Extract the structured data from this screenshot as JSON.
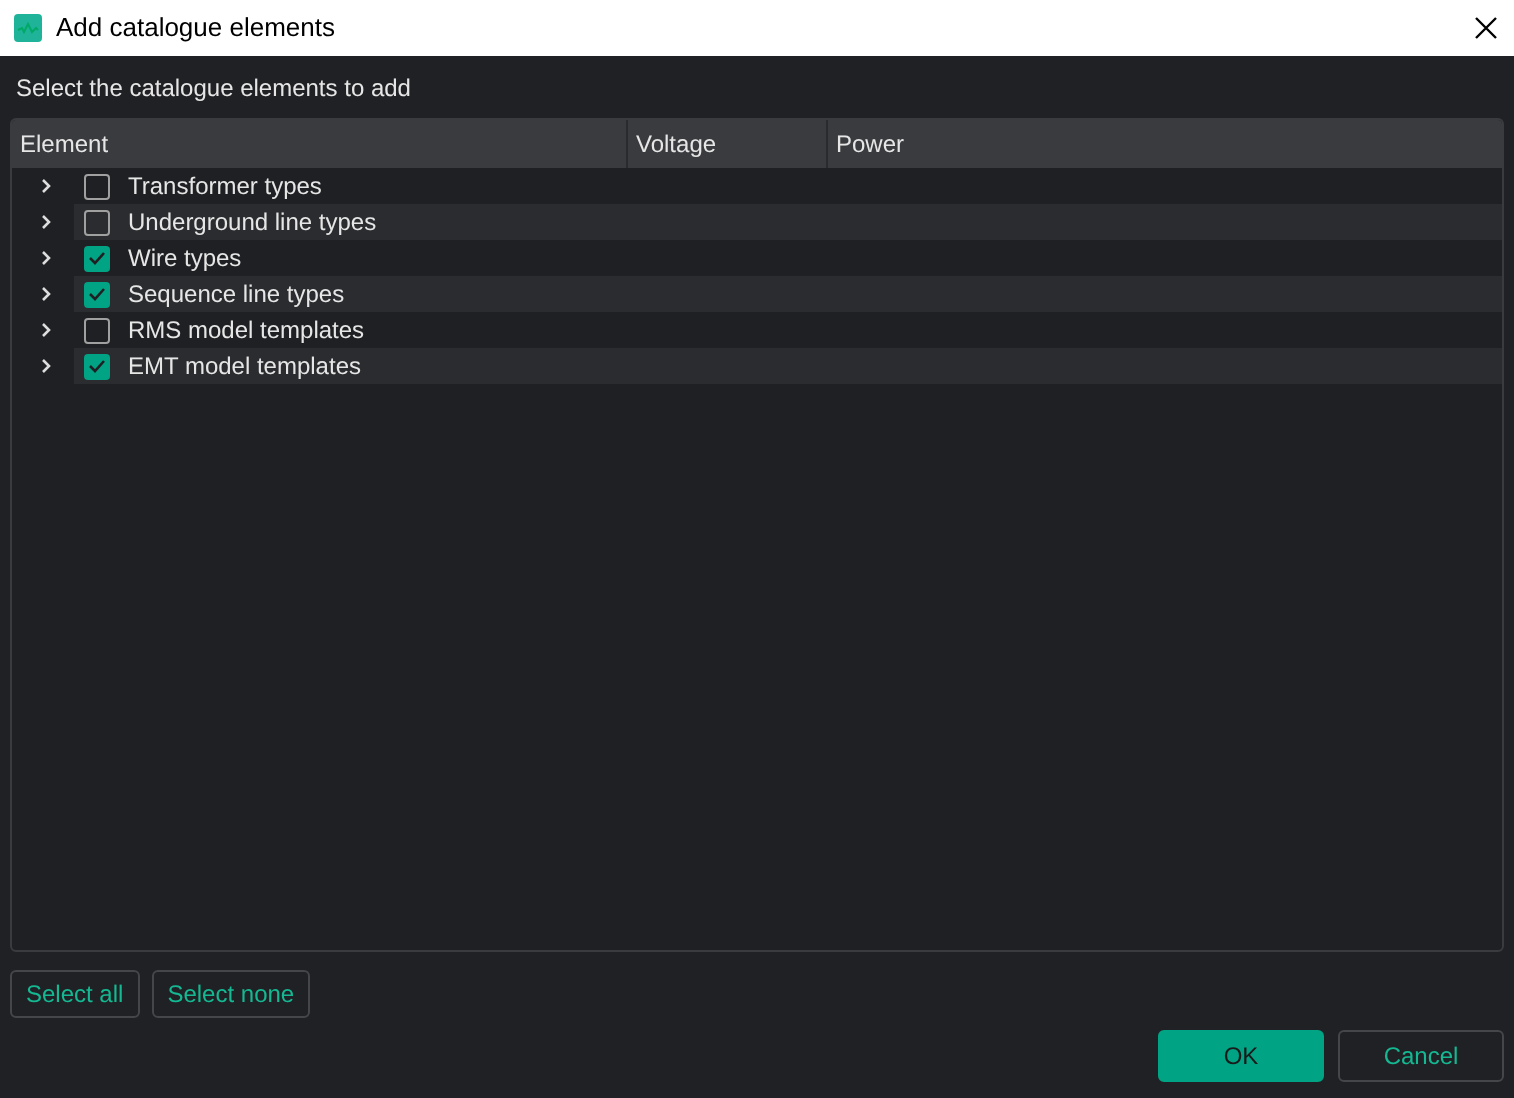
{
  "window": {
    "title": "Add catalogue elements"
  },
  "instruction": "Select the catalogue elements to add",
  "table": {
    "columns": [
      "Element",
      "Voltage",
      "Power"
    ],
    "rows": [
      {
        "label": "Transformer types",
        "checked": false,
        "expanded": false
      },
      {
        "label": "Underground line types",
        "checked": false,
        "expanded": false
      },
      {
        "label": "Wire types",
        "checked": true,
        "expanded": false
      },
      {
        "label": "Sequence line types",
        "checked": true,
        "expanded": false
      },
      {
        "label": "RMS model templates",
        "checked": false,
        "expanded": false
      },
      {
        "label": "EMT model templates",
        "checked": true,
        "expanded": false
      }
    ]
  },
  "selection_buttons": [
    "Select all",
    "Select none"
  ],
  "dialog_buttons": [
    {
      "label": "OK",
      "kind": "primary"
    },
    {
      "label": "Cancel",
      "kind": "secondary"
    }
  ]
}
